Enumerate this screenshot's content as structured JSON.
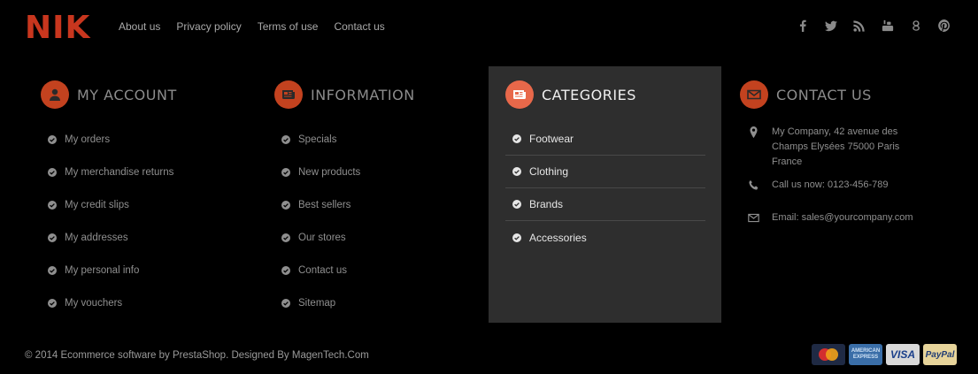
{
  "brand": {
    "logo": "NIK",
    "color": "#c8361e"
  },
  "top_nav": [
    "About us",
    "Privacy policy",
    "Terms of use",
    "Contact us"
  ],
  "social_icons": [
    "facebook-icon",
    "twitter-icon",
    "rss-icon",
    "youtube-icon",
    "google-plus-icon",
    "pinterest-icon"
  ],
  "my_account": {
    "title": "MY ACCOUNT",
    "items": [
      "My orders",
      "My merchandise returns",
      "My credit slips",
      "My addresses",
      "My personal info",
      "My vouchers"
    ]
  },
  "information": {
    "title": "INFORMATION",
    "items": [
      "Specials",
      "New products",
      "Best sellers",
      "Our stores",
      "Contact us",
      "Sitemap"
    ]
  },
  "categories": {
    "title": "CATEGORIES",
    "items": [
      "Footwear",
      "Clothing",
      "Brands",
      "Accessories"
    ]
  },
  "contact": {
    "title": "CONTACT US",
    "address": "My Company, 42 avenue des Champs Elysées 75000 Paris France",
    "phone": "Call us now: 0123-456-789",
    "email": "Email: sales@yourcompany.com"
  },
  "footer": {
    "copyright": "© 2014 Ecommerce software by PrestaShop. Designed By MagenTech.Com"
  },
  "payments": {
    "amex_label": "AMERICAN EXPRESS",
    "visa_label": "VISA",
    "paypal_label": "PayPal"
  },
  "accent_color": "#c3421f"
}
